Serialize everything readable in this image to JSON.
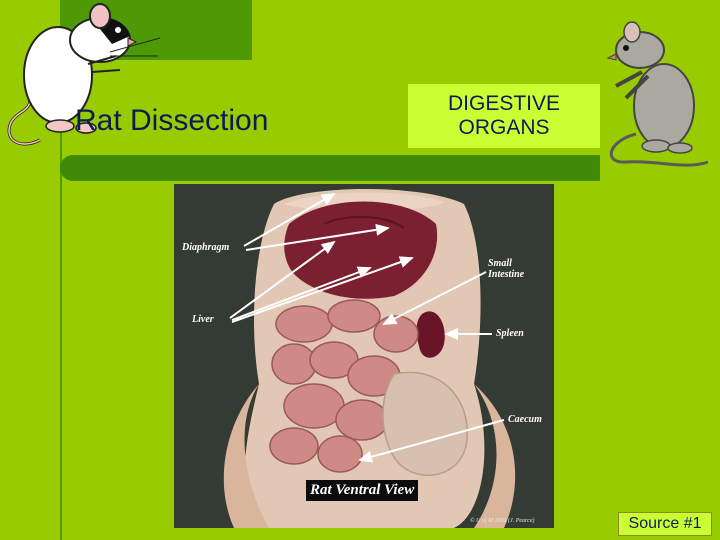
{
  "slide": {
    "title": "Rat Dissection",
    "subtitle_line1": "DIGESTIVE",
    "subtitle_line2": "ORGANS",
    "source_label": "Source #1"
  },
  "photo": {
    "labels": {
      "diaphragm": "Diaphragm",
      "small_intestine_line1": "Small",
      "small_intestine_line2": "Intestine",
      "liver": "Liver",
      "spleen": "Spleen",
      "caecum": "Caecum"
    },
    "caption": "Rat Ventral View",
    "copyright": "© U of M 2002 (J. Pearce)"
  },
  "colors": {
    "background": "#99cc00",
    "dark_green": "#4e9a06",
    "highlight": "#ccff33",
    "title_text": "#0b1d54"
  },
  "icons": [
    "rat-left-icon",
    "rat-right-icon"
  ]
}
